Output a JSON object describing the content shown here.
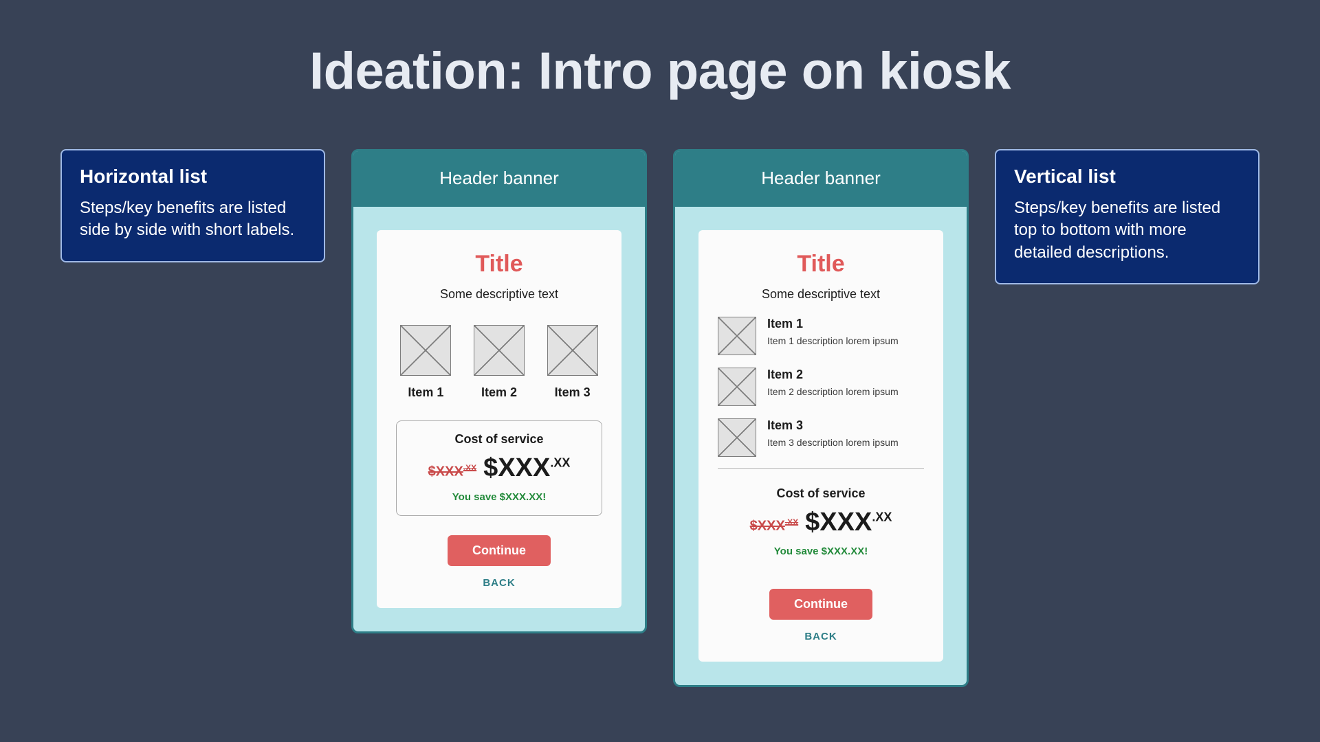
{
  "page_title": "Ideation: Intro page on kiosk",
  "note_left": {
    "title": "Horizontal list",
    "body": "Steps/key benefits are listed side by side with short labels."
  },
  "note_right": {
    "title": "Vertical list",
    "body": "Steps/key benefits are listed top to bottom with more detailed descriptions."
  },
  "common": {
    "header": "Header banner",
    "title": "Title",
    "desc": "Some descriptive text",
    "cost_label": "Cost of service",
    "old_price_whole": "$XXX",
    "old_price_cents": ".XX",
    "new_price_whole": "$XXX",
    "new_price_cents": ".XX",
    "save_text": "You save $XXX.XX!",
    "continue_label": "Continue",
    "back_label": "BACK"
  },
  "horizontal": {
    "items": [
      {
        "label": "Item 1"
      },
      {
        "label": "Item 2"
      },
      {
        "label": "Item 3"
      }
    ]
  },
  "vertical": {
    "items": [
      {
        "label": "Item 1",
        "desc": "Item 1 description lorem ipsum"
      },
      {
        "label": "Item 2",
        "desc": "Item 2 description lorem ipsum"
      },
      {
        "label": "Item 3",
        "desc": "Item 3 description lorem ipsum"
      }
    ]
  }
}
